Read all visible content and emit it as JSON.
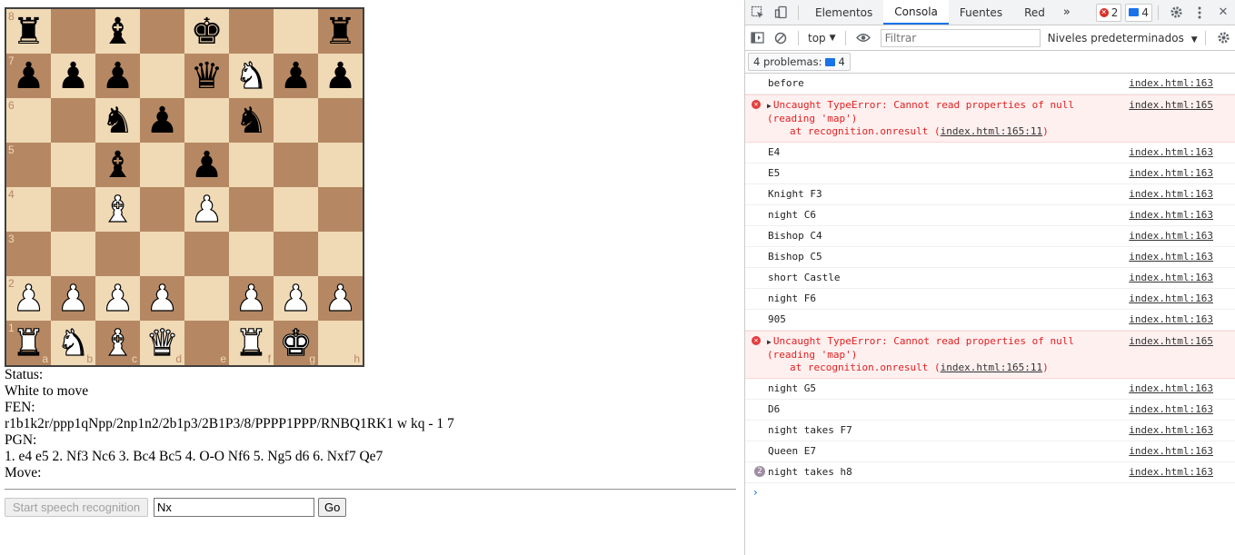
{
  "board": {
    "light_color": "#f0d9b5",
    "dark_color": "#b58863",
    "pieces": {
      "a8": "bR",
      "c8": "bB",
      "e8": "bK",
      "h8": "bR",
      "a7": "bP",
      "b7": "bP",
      "c7": "bP",
      "e7": "bQ",
      "f7": "wN",
      "g7": "bP",
      "h7": "bP",
      "c6": "bN",
      "d6": "bP",
      "f6": "bN",
      "c5": "bB",
      "e5": "bP",
      "c4": "wB",
      "e4": "wP",
      "a2": "wP",
      "b2": "wP",
      "c2": "wP",
      "d2": "wP",
      "f2": "wP",
      "g2": "wP",
      "h2": "wP",
      "a1": "wR",
      "b1": "wN",
      "c1": "wB",
      "d1": "wQ",
      "f1": "wR",
      "g1": "wK"
    },
    "rank_labels": [
      "8",
      "7",
      "6",
      "5",
      "4",
      "3",
      "2",
      "1"
    ],
    "file_labels": [
      "a",
      "b",
      "c",
      "d",
      "e",
      "f",
      "g",
      "h"
    ]
  },
  "info": {
    "status_label": "Status:",
    "status_value": "White to move",
    "fen_label": "FEN:",
    "fen_value": "r1b1k2r/ppp1qNpp/2np1n2/2b1p3/2B1P3/8/PPPP1PPP/RNBQ1RK1 w kq - 1 7",
    "pgn_label": "PGN:",
    "pgn_value": "1. e4 e5 2. Nf3 Nc6 3. Bc4 Bc5 4. O-O Nf6 5. Ng5 d6 6. Nxf7 Qe7",
    "move_label": "Move:"
  },
  "controls": {
    "speech_button": "Start speech recognition",
    "move_input_value": "Nx",
    "go_button": "Go"
  },
  "devtools": {
    "tabs": [
      "Elementos",
      "Consola",
      "Fuentes",
      "Red"
    ],
    "active_tab": "Consola",
    "more_tabs": "»",
    "error_count": "2",
    "message_count": "4",
    "context": "top",
    "filter_placeholder": "Filtrar",
    "levels": "Niveles predeterminados",
    "issues_label": "4 problemas:",
    "issues_count": "4",
    "accent_color": "#1a73e8",
    "error_color": "#e21f1f",
    "logs": [
      {
        "type": "log",
        "text": "before",
        "src": "index.html:163"
      },
      {
        "type": "error",
        "text": "Uncaught TypeError: Cannot read properties of null",
        "text2": "(reading 'map')",
        "text3_prefix": "at recognition.onresult (",
        "text3_link": "index.html:165:11",
        "text3_suffix": ")",
        "src": "index.html:165"
      },
      {
        "type": "log",
        "text": "E4",
        "src": "index.html:163"
      },
      {
        "type": "log",
        "text": "E5",
        "src": "index.html:163"
      },
      {
        "type": "log",
        "text": "Knight F3",
        "src": "index.html:163"
      },
      {
        "type": "log",
        "text": "night C6",
        "src": "index.html:163"
      },
      {
        "type": "log",
        "text": "Bishop C4",
        "src": "index.html:163"
      },
      {
        "type": "log",
        "text": "Bishop C5",
        "src": "index.html:163"
      },
      {
        "type": "log",
        "text": "short Castle",
        "src": "index.html:163"
      },
      {
        "type": "log",
        "text": "night F6",
        "src": "index.html:163"
      },
      {
        "type": "log",
        "text": "905",
        "src": "index.html:163"
      },
      {
        "type": "error",
        "text": "Uncaught TypeError: Cannot read properties of null",
        "text2": "(reading 'map')",
        "text3_prefix": "at recognition.onresult (",
        "text3_link": "index.html:165:11",
        "text3_suffix": ")",
        "src": "index.html:165"
      },
      {
        "type": "log",
        "text": "night G5",
        "src": "index.html:163"
      },
      {
        "type": "log",
        "text": "D6",
        "src": "index.html:163"
      },
      {
        "type": "log",
        "text": "night takes F7",
        "src": "index.html:163"
      },
      {
        "type": "log",
        "text": "Queen E7",
        "src": "index.html:163"
      },
      {
        "type": "repeat",
        "count": "2",
        "text": "night takes h8",
        "src": "index.html:163"
      }
    ]
  }
}
